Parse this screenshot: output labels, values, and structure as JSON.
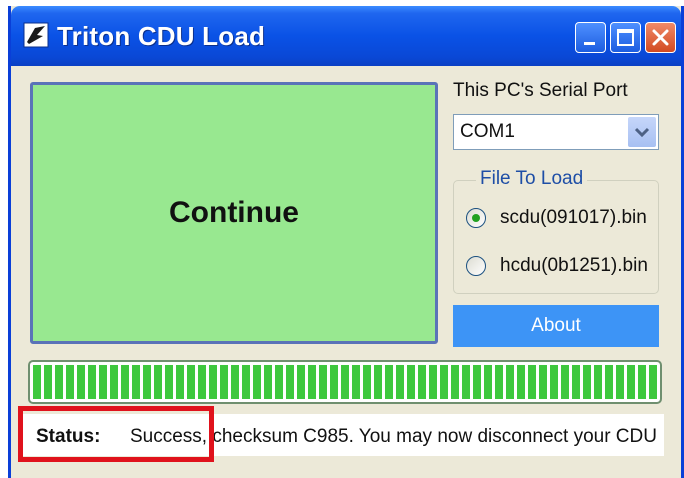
{
  "window": {
    "title": "Triton CDU Load",
    "app_icon": "app-icon",
    "controls": [
      "minimize-icon",
      "maximize-icon",
      "close-icon"
    ]
  },
  "main": {
    "continue_label": "Continue"
  },
  "serial_port": {
    "label": "This PC's Serial Port",
    "selected": "COM1"
  },
  "file_group": {
    "legend": "File To Load",
    "options": [
      {
        "label": "scdu(091017).bin",
        "checked": true
      },
      {
        "label": "hcdu(0b1251).bin",
        "checked": false
      }
    ]
  },
  "about_label": "About",
  "progress": {
    "percent": 100
  },
  "status": {
    "label": "Status:",
    "text": "Success, checksum C985. You may now disconnect your CDU"
  },
  "colors": {
    "titlebar": "#0a52e6",
    "continue_bg": "#98e890",
    "about_bg": "#3d94f6",
    "progress_fill": "#3ec83e",
    "highlight": "#e0121c"
  }
}
